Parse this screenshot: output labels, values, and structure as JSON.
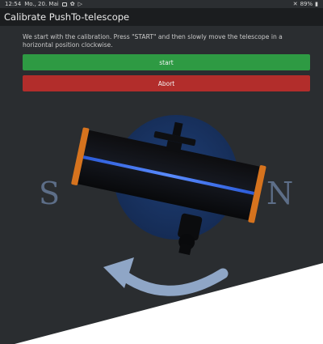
{
  "status_bar": {
    "time": "12:54",
    "date": "Mo., 20. Mai",
    "battery": "89%"
  },
  "app_bar": {
    "title": "Calibrate PushTo-telescope"
  },
  "instructions": "We start with the calibration. Press \"START\" and then slowly move the telescope in a horizontal position clockwise.",
  "buttons": {
    "start": "start",
    "abort": "Abort"
  },
  "illustration": {
    "left_label": "S",
    "right_label": "N"
  },
  "colors": {
    "start_button": "#2e9a43",
    "abort_button": "#b22d2b",
    "circle": "#1a3564",
    "arrow": "#8fa6c6"
  }
}
